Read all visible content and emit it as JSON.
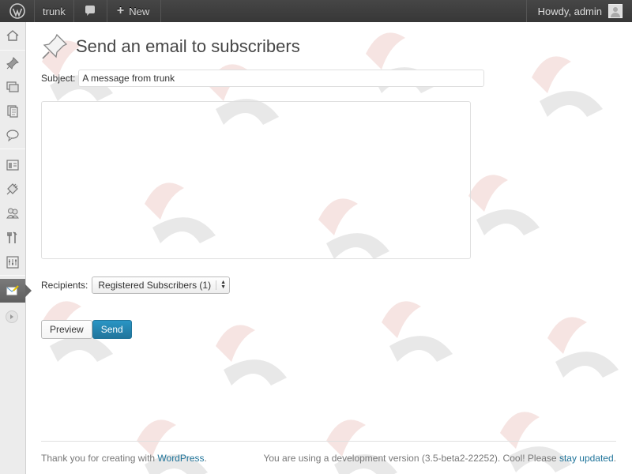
{
  "adminbar": {
    "site_name": "trunk",
    "new_label": "New",
    "howdy": "Howdy, admin"
  },
  "page": {
    "title": "Send an email to subscribers",
    "subject_label": "Subject:",
    "subject_value": "A message from trunk",
    "body_value": "",
    "recipients_label": "Recipients:",
    "recipients_selected": "Registered Subscribers (1)",
    "preview_label": "Preview",
    "send_label": "Send"
  },
  "footer": {
    "thanks_prefix": "Thank you for creating with ",
    "thanks_link": "WordPress",
    "thanks_suffix": ".",
    "version_text": "You are using a development version (3.5-beta2-22252). Cool! Please ",
    "version_link": "stay updated",
    "version_suffix": "."
  },
  "sidebar": {
    "icons": [
      "dashboard-icon",
      "posts-icon",
      "media-icon",
      "pages-icon",
      "comments-icon",
      "appearance-icon",
      "plugins-icon",
      "users-icon",
      "tools-icon",
      "settings-icon",
      "subscribe2-icon",
      "collapse-icon"
    ]
  },
  "colors": {
    "adminbar_bg": "#464646",
    "sidebar_bg": "#ececec",
    "primary_button": "#21759b",
    "link": "#21759b",
    "watermark": "#d9534f"
  }
}
